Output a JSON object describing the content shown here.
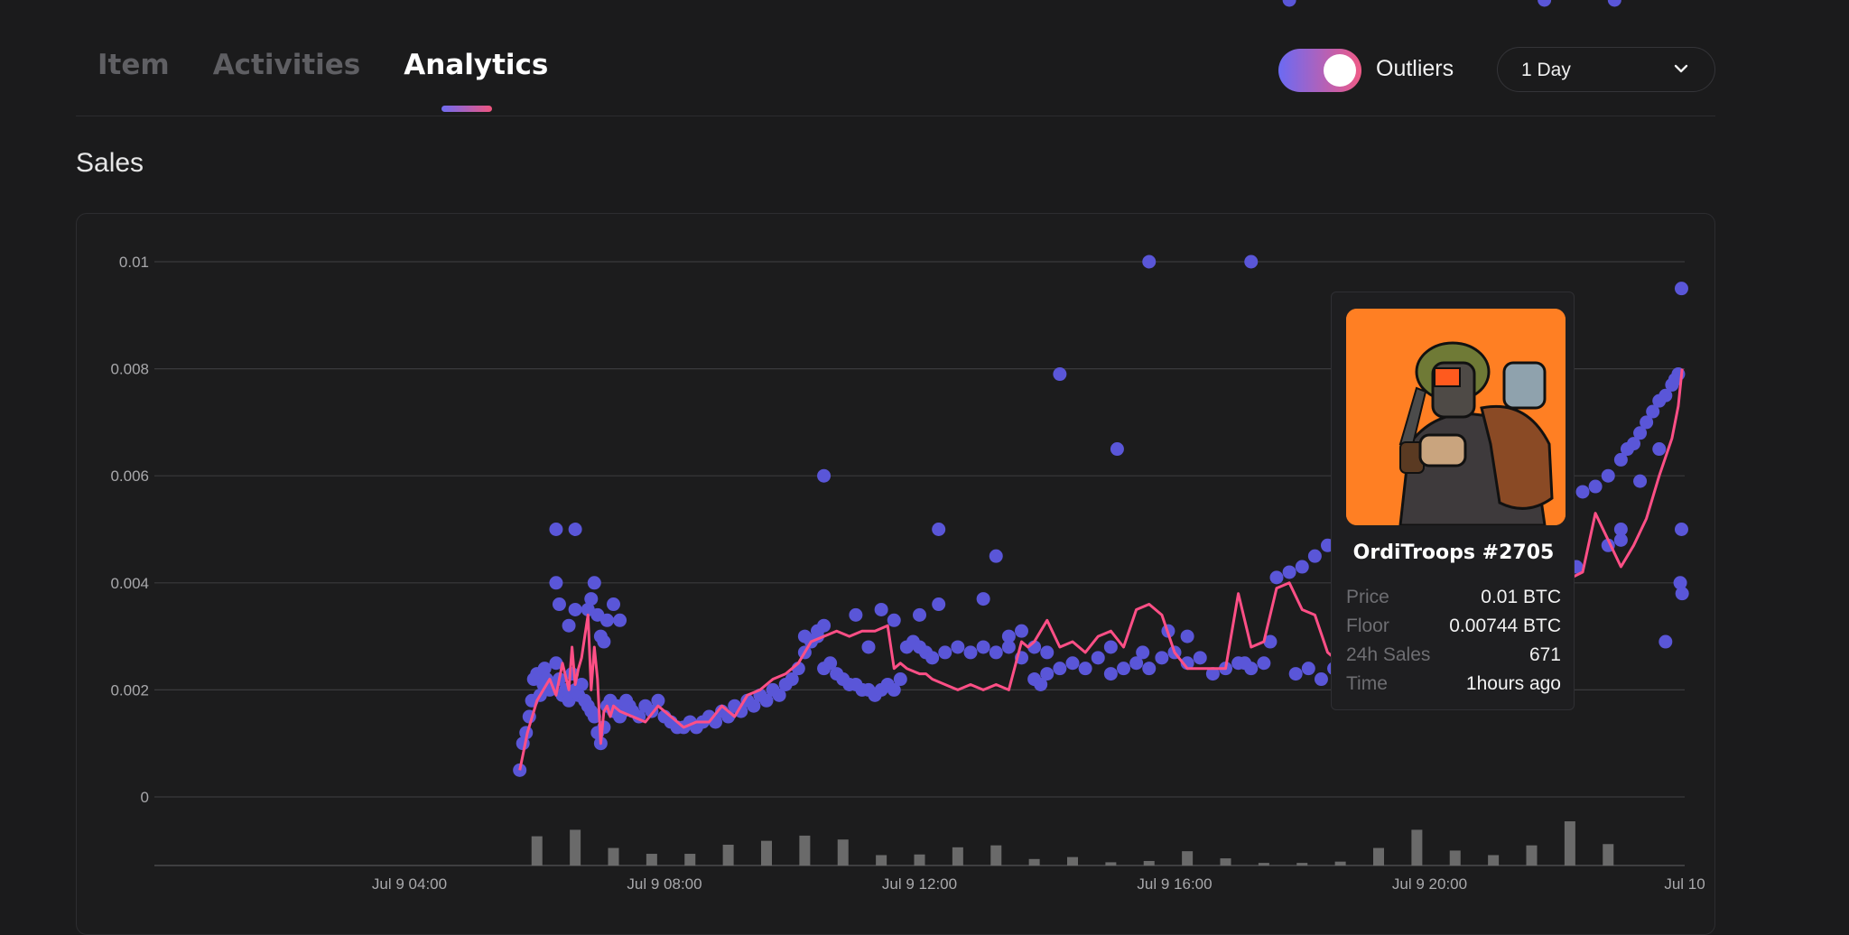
{
  "tabs": [
    {
      "label": "Item",
      "active": false
    },
    {
      "label": "Activities",
      "active": false
    },
    {
      "label": "Analytics",
      "active": true
    }
  ],
  "controls": {
    "outliers_label": "Outliers",
    "outliers_on": true,
    "period_selected": "1 Day"
  },
  "section_title": "Sales",
  "colors": {
    "scatter": "#5a56d8",
    "line": "#ff4f86",
    "volume_bar": "#6a6a6a",
    "accent_gradient": [
      "#6b6af3",
      "#f05a86"
    ]
  },
  "tooltip": {
    "name": "OrdiTroops #2705",
    "rows": [
      {
        "label": "Price",
        "value": "0.01 BTC"
      },
      {
        "label": "Floor",
        "value": "0.00744 BTC"
      },
      {
        "label": "24h Sales",
        "value": "671"
      },
      {
        "label": "Time",
        "value": "1hours ago"
      }
    ]
  },
  "chart_data": {
    "type": "scatter",
    "title": "",
    "xlabel": "",
    "ylabel": "",
    "y_unit": "BTC",
    "ylim": [
      0,
      0.01
    ],
    "y_ticks": [
      "0",
      "0.002",
      "0.004",
      "0.006",
      "0.008",
      "0.01"
    ],
    "x_tick_labels": [
      "Jul 9 04:00",
      "Jul 9 08:00",
      "Jul 9 12:00",
      "Jul 9 16:00",
      "Jul 9 20:00",
      "Jul 10"
    ],
    "x_range_hours": [
      0,
      24
    ],
    "grid": true,
    "sales_scatter": {
      "x_hours_since_jul9_00": [
        5.73,
        5.78,
        5.83,
        5.88,
        5.92,
        5.95,
        6.0,
        6.05,
        6.1,
        6.12,
        6.15,
        6.2,
        6.25,
        6.3,
        6.35,
        6.4,
        6.45,
        6.5,
        6.55,
        6.6,
        6.65,
        6.7,
        6.75,
        6.8,
        6.85,
        6.9,
        6.95,
        7.0,
        7.05,
        7.1,
        7.15,
        7.2,
        7.25,
        7.3,
        7.35,
        7.4,
        7.45,
        7.5,
        7.6,
        7.7,
        7.8,
        7.9,
        8.0,
        8.1,
        8.2,
        8.3,
        8.4,
        8.5,
        8.6,
        8.7,
        8.8,
        8.9,
        9.0,
        9.1,
        9.2,
        9.3,
        9.4,
        9.5,
        9.6,
        9.7,
        9.8,
        9.9,
        10.0,
        10.1,
        10.2,
        10.3,
        10.4,
        10.5,
        10.6,
        10.7,
        10.8,
        10.9,
        11.0,
        11.1,
        11.2,
        11.3,
        11.4,
        11.5,
        11.6,
        11.7,
        11.8,
        11.9,
        12.0,
        12.1,
        12.2,
        12.4,
        12.6,
        12.8,
        13.0,
        13.2,
        13.4,
        13.6,
        13.8,
        13.9,
        14.0,
        14.2,
        14.4,
        14.6,
        14.8,
        15.0,
        15.2,
        15.4,
        15.6,
        15.8,
        16.0,
        16.2,
        16.4,
        16.6,
        16.8,
        17.0,
        17.2,
        17.4,
        17.6,
        17.8,
        18.0,
        18.2,
        18.4,
        18.6,
        18.8,
        19.0,
        19.2,
        22.4,
        22.6,
        22.8,
        23.0,
        23.1,
        23.2,
        23.3,
        23.4,
        23.5,
        23.6,
        23.7,
        23.8,
        23.85,
        23.9,
        23.93,
        23.96,
        6.3,
        6.35,
        6.8,
        6.85,
        6.9,
        6.95,
        7.0,
        7.05,
        7.1,
        6.5,
        6.6,
        7.2,
        7.3,
        10.2,
        10.4,
        10.5,
        11.0,
        11.2,
        11.4,
        11.6,
        12.0,
        12.3,
        13.0,
        13.4,
        13.6,
        13.8,
        14.0,
        15.0,
        15.5,
        15.9,
        16.2,
        17.1,
        17.5,
        17.9,
        18.1,
        18.3,
        18.5,
        18.7,
        19.0,
        19.3,
        22.3,
        22.8,
        23.0,
        23.3,
        23.6,
        23.7,
        23.95,
        21.8,
        23.0,
        23.95,
        6.3,
        6.6,
        10.5,
        12.3,
        13.2,
        14.2,
        15.1,
        15.6,
        17.2,
        17.8,
        21.8,
        22.9
      ],
      "y_btc": [
        0.0005,
        0.001,
        0.0012,
        0.0015,
        0.0018,
        0.0022,
        0.0023,
        0.0019,
        0.0021,
        0.0024,
        0.0022,
        0.002,
        0.0021,
        0.0025,
        0.0022,
        0.0019,
        0.002,
        0.0018,
        0.0023,
        0.002,
        0.0019,
        0.0021,
        0.0018,
        0.0017,
        0.0016,
        0.0015,
        0.0012,
        0.001,
        0.0013,
        0.0017,
        0.0018,
        0.0016,
        0.0017,
        0.0015,
        0.0016,
        0.0018,
        0.0017,
        0.0016,
        0.0015,
        0.0017,
        0.0016,
        0.0018,
        0.0015,
        0.0014,
        0.0013,
        0.0013,
        0.0014,
        0.0013,
        0.0014,
        0.0015,
        0.0014,
        0.0016,
        0.0015,
        0.0017,
        0.0016,
        0.0018,
        0.0017,
        0.0019,
        0.0018,
        0.002,
        0.0019,
        0.0021,
        0.0022,
        0.0024,
        0.0027,
        0.0029,
        0.003,
        0.0024,
        0.0025,
        0.0023,
        0.0022,
        0.0021,
        0.0021,
        0.002,
        0.002,
        0.0019,
        0.002,
        0.0021,
        0.002,
        0.0022,
        0.0028,
        0.0029,
        0.0028,
        0.0027,
        0.0026,
        0.0027,
        0.0028,
        0.0027,
        0.0028,
        0.0027,
        0.0028,
        0.0026,
        0.0022,
        0.0021,
        0.0023,
        0.0024,
        0.0025,
        0.0024,
        0.0026,
        0.0023,
        0.0024,
        0.0025,
        0.0024,
        0.0026,
        0.0027,
        0.0025,
        0.0026,
        0.0023,
        0.0024,
        0.0025,
        0.0024,
        0.0025,
        0.0041,
        0.0042,
        0.0043,
        0.0045,
        0.0047,
        0.0046,
        0.0048,
        0.005,
        0.0055,
        0.0057,
        0.0058,
        0.006,
        0.0063,
        0.0065,
        0.0066,
        0.0068,
        0.007,
        0.0072,
        0.0074,
        0.0075,
        0.0077,
        0.0078,
        0.0079,
        0.004,
        0.0038,
        0.004,
        0.0036,
        0.0035,
        0.0037,
        0.004,
        0.0034,
        0.003,
        0.0029,
        0.0033,
        0.0032,
        0.0035,
        0.0036,
        0.0033,
        0.003,
        0.0031,
        0.0032,
        0.0034,
        0.0028,
        0.0035,
        0.0033,
        0.0034,
        0.0036,
        0.0037,
        0.003,
        0.0031,
        0.0028,
        0.0027,
        0.0028,
        0.0027,
        0.0031,
        0.003,
        0.0025,
        0.0029,
        0.0023,
        0.0024,
        0.0022,
        0.0024,
        0.0021,
        0.0042,
        0.0044,
        0.0043,
        0.0047,
        0.0048,
        0.0059,
        0.0065,
        0.0029,
        0.0095,
        0.0069,
        0.005,
        0.005,
        0.005,
        0.005,
        0.006,
        0.005,
        0.0045,
        0.0079,
        0.0065,
        0.01,
        0.01
      ],
      "outliers_count_note": "dots above the line"
    },
    "floor_line": {
      "x_hours_since_jul9_00": [
        5.73,
        5.85,
        6.0,
        6.1,
        6.2,
        6.3,
        6.4,
        6.5,
        6.55,
        6.6,
        6.65,
        6.7,
        6.75,
        6.8,
        6.85,
        6.9,
        6.95,
        7.0,
        7.05,
        7.1,
        7.15,
        7.2,
        7.3,
        7.5,
        7.7,
        7.9,
        8.1,
        8.3,
        8.5,
        8.7,
        8.9,
        9.1,
        9.3,
        9.5,
        9.7,
        9.9,
        10.1,
        10.3,
        10.5,
        10.7,
        10.9,
        11.1,
        11.3,
        11.5,
        11.6,
        11.7,
        11.8,
        12.0,
        12.1,
        12.2,
        12.4,
        12.6,
        12.8,
        13.0,
        13.2,
        13.4,
        13.6,
        13.7,
        13.8,
        14.0,
        14.2,
        14.4,
        14.6,
        14.8,
        15.0,
        15.2,
        15.4,
        15.6,
        15.8,
        16.0,
        16.2,
        16.4,
        16.6,
        16.8,
        17.0,
        17.2,
        17.4,
        17.6,
        17.8,
        18.0,
        18.2,
        18.4,
        18.6,
        18.8,
        19.0,
        19.2,
        22.4,
        22.6,
        22.8,
        23.0,
        23.2,
        23.4,
        23.6,
        23.8,
        23.9,
        23.96
      ],
      "y_btc": [
        0.0005,
        0.0012,
        0.0018,
        0.002,
        0.0022,
        0.0019,
        0.0025,
        0.002,
        0.0028,
        0.0021,
        0.0024,
        0.0026,
        0.003,
        0.0034,
        0.002,
        0.0028,
        0.0022,
        0.001,
        0.0016,
        0.0017,
        0.0015,
        0.0017,
        0.0016,
        0.0015,
        0.0014,
        0.0017,
        0.0015,
        0.0013,
        0.0014,
        0.0014,
        0.0017,
        0.0015,
        0.0019,
        0.002,
        0.0022,
        0.0023,
        0.0025,
        0.0029,
        0.003,
        0.0031,
        0.003,
        0.0031,
        0.0031,
        0.0032,
        0.0024,
        0.0025,
        0.0024,
        0.0023,
        0.0023,
        0.0022,
        0.0021,
        0.002,
        0.0021,
        0.002,
        0.0021,
        0.002,
        0.0029,
        0.0028,
        0.0029,
        0.0033,
        0.0028,
        0.0029,
        0.0027,
        0.003,
        0.0031,
        0.0028,
        0.0035,
        0.0036,
        0.0034,
        0.0027,
        0.0024,
        0.0024,
        0.0024,
        0.0024,
        0.0038,
        0.0028,
        0.0029,
        0.0039,
        0.004,
        0.0035,
        0.0034,
        0.0027,
        0.0025,
        0.0024,
        0.0023,
        0.0023,
        0.0042,
        0.0053,
        0.0048,
        0.0043,
        0.0047,
        0.0052,
        0.006,
        0.0067,
        0.0073,
        0.008
      ]
    },
    "volume_bars": {
      "x_hours_since_jul9_00": [
        6.0,
        6.6,
        7.2,
        7.8,
        8.4,
        9.0,
        9.6,
        10.2,
        10.8,
        11.4,
        12.0,
        12.6,
        13.2,
        13.8,
        14.4,
        15.0,
        15.6,
        16.2,
        16.8,
        17.4,
        18.0,
        18.6,
        19.2,
        19.8,
        20.4,
        21.0,
        21.6,
        22.2,
        22.8,
        23.4,
        24.0
      ],
      "relative_volume": [
        0.45,
        0.55,
        0.27,
        0.18,
        0.18,
        0.32,
        0.38,
        0.46,
        0.4,
        0.16,
        0.17,
        0.28,
        0.31,
        0.1,
        0.13,
        0.05,
        0.07,
        0.22,
        0.11,
        0.04,
        0.04,
        0.06,
        0.27,
        0.55,
        0.23,
        0.16,
        0.31,
        0.68,
        0.33,
        0.0,
        0.0
      ]
    }
  }
}
